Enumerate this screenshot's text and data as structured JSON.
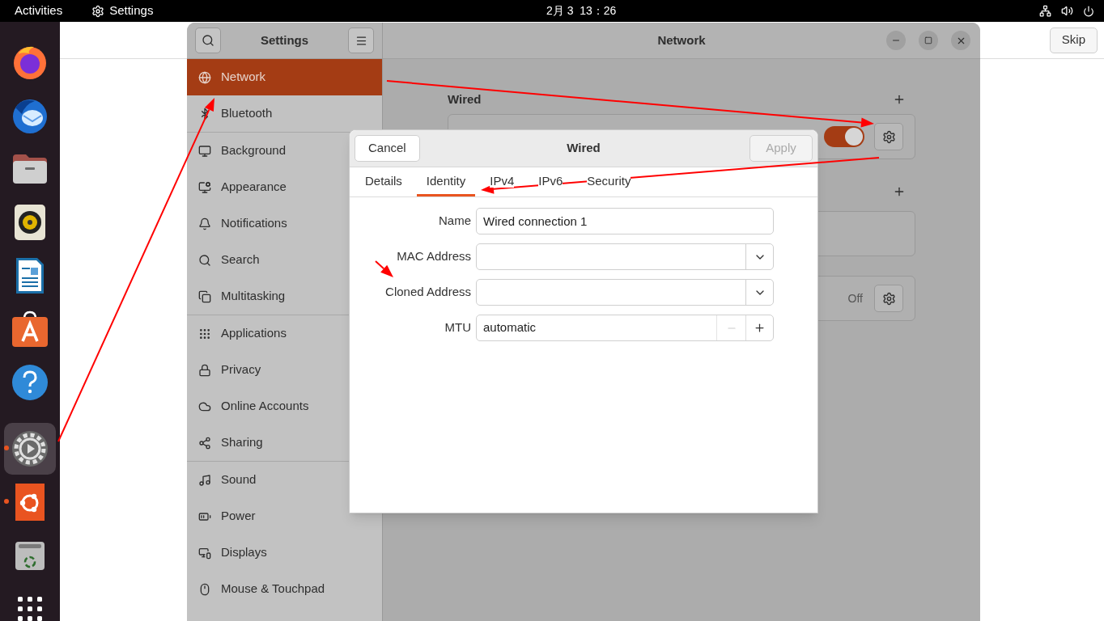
{
  "top_bar": {
    "activities": "Activities",
    "app_name": "Settings",
    "clock": "2月 3  13：26"
  },
  "dock": {
    "groups": [
      [
        {
          "kind": "browser",
          "running": false,
          "selected": false
        },
        {
          "kind": "mail",
          "running": false,
          "selected": false
        },
        {
          "kind": "files",
          "running": false,
          "selected": false
        },
        {
          "kind": "music",
          "running": false,
          "selected": false
        },
        {
          "kind": "writer",
          "running": false,
          "selected": false
        },
        {
          "kind": "store",
          "running": false,
          "selected": false
        },
        {
          "kind": "help",
          "running": false,
          "selected": false
        }
      ],
      [
        {
          "kind": "settings",
          "running": true,
          "selected": true
        },
        {
          "kind": "ubuntu",
          "running": true,
          "selected": false
        },
        {
          "kind": "trash",
          "running": false,
          "selected": false
        },
        {
          "kind": "apps",
          "running": false,
          "selected": false
        }
      ]
    ]
  },
  "welcome": {
    "skip": "Skip"
  },
  "settings": {
    "sidebar_title": "Settings",
    "window_title": "Network",
    "sidebar": [
      [
        {
          "label": "Network",
          "selected": true
        },
        {
          "label": "Bluetooth",
          "selected": false
        }
      ],
      [
        {
          "label": "Background",
          "selected": false
        },
        {
          "label": "Appearance",
          "selected": false
        },
        {
          "label": "Notifications",
          "selected": false
        },
        {
          "label": "Search",
          "selected": false
        },
        {
          "label": "Multitasking",
          "selected": false
        }
      ],
      [
        {
          "label": "Applications",
          "selected": false
        },
        {
          "label": "Privacy",
          "selected": false
        },
        {
          "label": "Online Accounts",
          "selected": false
        },
        {
          "label": "Sharing",
          "selected": false
        }
      ],
      [
        {
          "label": "Sound",
          "selected": false
        },
        {
          "label": "Power",
          "selected": false
        },
        {
          "label": "Displays",
          "selected": false
        },
        {
          "label": "Mouse & Touchpad",
          "selected": false
        }
      ]
    ],
    "wired": {
      "title": "Wired",
      "on": true
    },
    "other_card": {
      "status": "Off"
    }
  },
  "dialog": {
    "cancel": "Cancel",
    "title": "Wired",
    "apply": "Apply",
    "apply_disabled": true,
    "tabs": [
      {
        "label": "Details",
        "selected": false
      },
      {
        "label": "Identity",
        "selected": true
      },
      {
        "label": "IPv4",
        "selected": false
      },
      {
        "label": "IPv6",
        "selected": false
      },
      {
        "label": "Security",
        "selected": false
      }
    ],
    "fields": [
      {
        "label": "Name",
        "kind": "text",
        "value": "Wired connection 1"
      },
      {
        "label": "MAC Address",
        "kind": "combo"
      },
      {
        "label": "Cloned Address",
        "kind": "combo"
      },
      {
        "label": "MTU",
        "kind": "spin",
        "value": "automatic",
        "minus_disabled": true
      }
    ]
  }
}
